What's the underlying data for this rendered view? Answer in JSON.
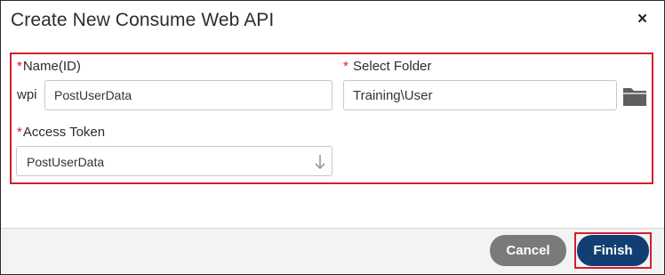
{
  "dialog": {
    "title": "Create New Consume Web API",
    "close_label": "×"
  },
  "form": {
    "name": {
      "required_marker": "*",
      "label": "Name(ID)",
      "prefix": "wpi",
      "value": "PostUserData"
    },
    "folder": {
      "required_marker": "*",
      "label": " Select Folder",
      "value": "Training\\User",
      "icon": "folder-icon"
    },
    "access_token": {
      "required_marker": "*",
      "label": "Access Token",
      "selected": "PostUserData",
      "icon": "arrow-down-icon"
    }
  },
  "footer": {
    "cancel_label": "Cancel",
    "finish_label": "Finish"
  },
  "colors": {
    "required": "#d0202e",
    "highlight_border": "#d0202e",
    "finish_bg": "#123f73",
    "cancel_bg": "#7a7a7a"
  }
}
